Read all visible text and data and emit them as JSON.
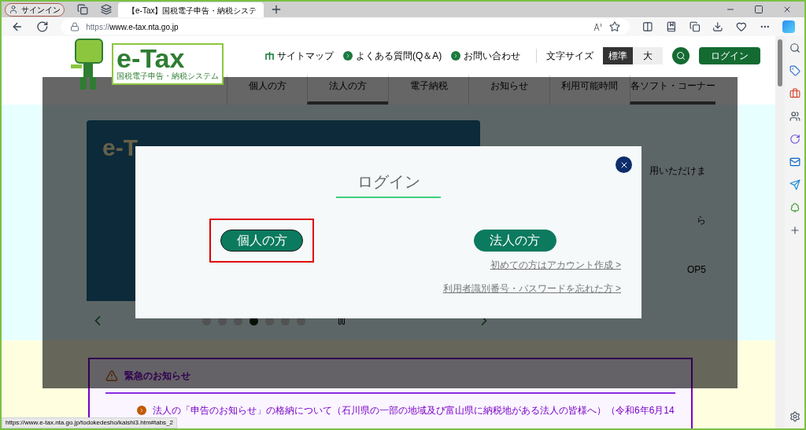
{
  "browser": {
    "profile": "サインイン",
    "tabs": [
      {
        "title": "【e-Tax】国税電子申告・納税システ",
        "selected": true
      }
    ],
    "url_scheme": "https://",
    "url_host": "www.e-tax.nta.go.jp",
    "status_url": "https://www.e-tax.nta.go.jp/todokedesho/kaishi3.htm#tabs_2"
  },
  "header": {
    "logo_title": "e-Tax",
    "logo_subtitle": "国税電子申告・納税システム",
    "utility_links": [
      {
        "kind": "sitemap",
        "label": "サイトマップ"
      },
      {
        "kind": "arrow",
        "label": "よくある質問(Q＆A)"
      },
      {
        "kind": "arrow",
        "label": "お問い合わせ"
      }
    ],
    "font_size_label": "文字サイズ",
    "font_sizes": [
      {
        "label": "標準",
        "selected": true
      },
      {
        "label": "大",
        "selected": false
      }
    ],
    "login_button": "ログイン"
  },
  "nav": [
    {
      "label": "個人の方",
      "selected": false
    },
    {
      "label": "法人の方",
      "selected": true
    },
    {
      "label": "電子納税",
      "selected": false
    },
    {
      "label": "お知らせ",
      "selected": false
    },
    {
      "label": "利用可能時間",
      "selected": false
    },
    {
      "label": "各ソフト・コーナー",
      "selected": true
    }
  ],
  "hero": {
    "title": "e-T"
  },
  "carousel": {
    "dots": [
      {
        "selected": false
      },
      {
        "selected": false
      },
      {
        "selected": false
      },
      {
        "selected": true
      },
      {
        "selected": false
      },
      {
        "selected": false
      },
      {
        "selected": false
      }
    ]
  },
  "side_fragments": [
    "用いただけま",
    "ら",
    "OP5"
  ],
  "notice": {
    "title": "緊急のお知らせ",
    "items": [
      "法人の「申告のお知らせ」の格納について（石川県の一部の地域及び富山県に納税地がある法人の皆様へ）（令和6年6月14"
    ]
  },
  "modal": {
    "title": "ログイン",
    "buttons": [
      {
        "label": "個人の方",
        "highlighted": true
      },
      {
        "label": "法人の方",
        "highlighted": false
      }
    ],
    "links": [
      "初めての方はアカウント作成 >",
      "利用者識別番号・パスワードを忘れた方 >"
    ]
  }
}
